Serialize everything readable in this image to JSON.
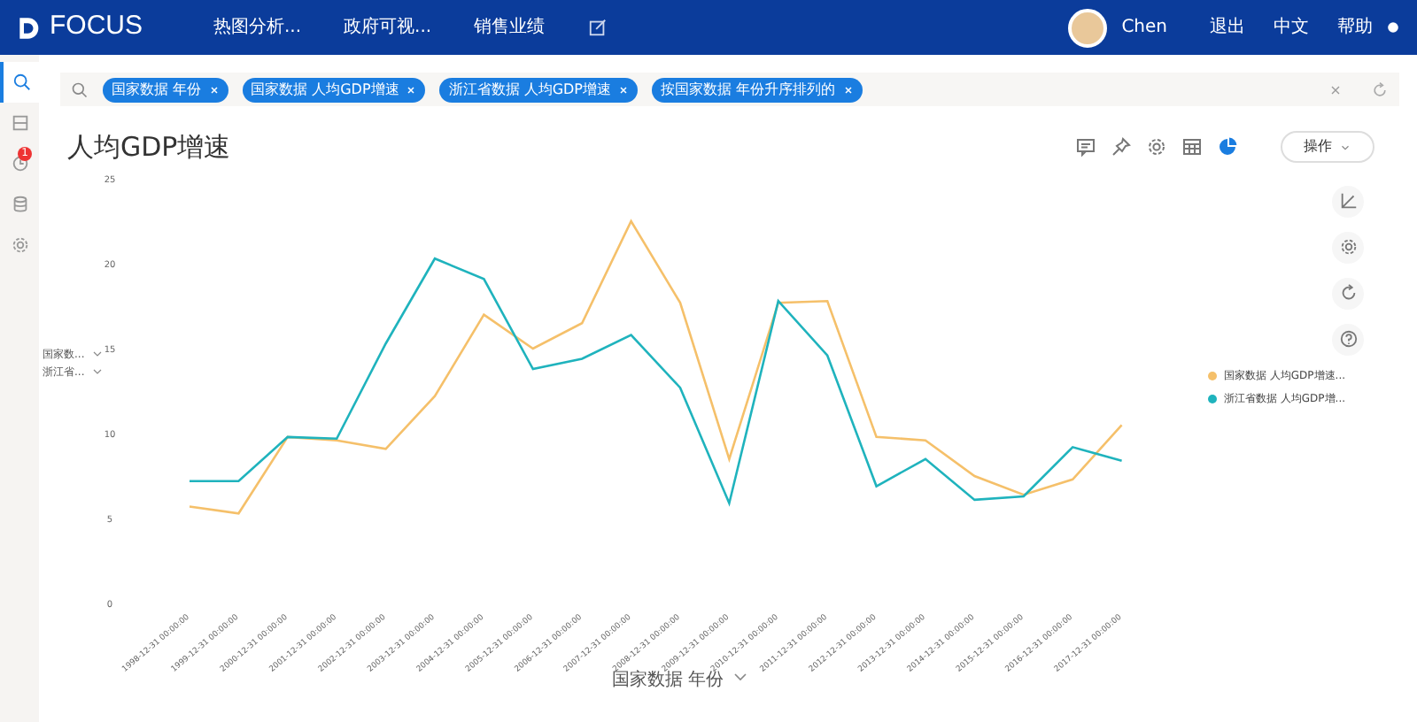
{
  "navbar": {
    "logo": "FOCUS",
    "menu": [
      {
        "label": "热图分析..."
      },
      {
        "label": "政府可视..."
      },
      {
        "label": "销售业绩"
      }
    ],
    "user": "Chen",
    "links": [
      "退出",
      "中文",
      "帮助"
    ]
  },
  "sidebar": {
    "items": [
      {
        "kind": "search",
        "selected": true
      },
      {
        "kind": "board",
        "selected": false
      },
      {
        "kind": "clock",
        "selected": false,
        "badge": "1"
      },
      {
        "kind": "database",
        "selected": false
      },
      {
        "kind": "gear",
        "selected": false
      }
    ]
  },
  "search": {
    "chips": [
      "国家数据 年份",
      "国家数据 人均GDP增速",
      "浙江省数据 人均GDP增速",
      "按国家数据 年份升序排列的"
    ]
  },
  "title": "人均GDP增速",
  "toolbar": {
    "tools": [
      {
        "kind": "comment",
        "selected": false
      },
      {
        "kind": "pin",
        "selected": false
      },
      {
        "kind": "gear",
        "selected": false
      },
      {
        "kind": "table",
        "selected": false
      },
      {
        "kind": "chart",
        "selected": true
      }
    ],
    "action": "操作"
  },
  "chart": {
    "axis_selectors": [
      "国家数...",
      "浙江省..."
    ],
    "legend": [
      "国家数据 人均GDP增速...",
      "浙江省数据 人均GDP增..."
    ],
    "side_tools": [
      {
        "kind": "axes"
      },
      {
        "kind": "gear"
      },
      {
        "kind": "refresh"
      },
      {
        "kind": "help"
      }
    ],
    "chart_data": {
      "type": "line",
      "xlabel": "国家数据 年份",
      "categories": [
        "1998-12-31 00:00:00",
        "1999-12-31 00:00:00",
        "2000-12-31 00:00:00",
        "2001-12-31 00:00:00",
        "2002-12-31 00:00:00",
        "2003-12-31 00:00:00",
        "2004-12-31 00:00:00",
        "2005-12-31 00:00:00",
        "2006-12-31 00:00:00",
        "2007-12-31 00:00:00",
        "2008-12-31 00:00:00",
        "2009-12-31 00:00:00",
        "2010-12-31 00:00:00",
        "2011-12-31 00:00:00",
        "2012-12-31 00:00:00",
        "2013-12-31 00:00:00",
        "2014-12-31 00:00:00",
        "2015-12-31 00:00:00",
        "2016-12-31 00:00:00",
        "2017-12-31 00:00:00"
      ],
      "ylim": [
        0,
        25
      ],
      "yticks": [
        0,
        5,
        10,
        15,
        20,
        25
      ],
      "series": [
        {
          "color": "#f5c06a",
          "values": [
            5.7,
            5.3,
            9.8,
            9.6,
            9.1,
            12.2,
            17,
            15,
            16.5,
            22.5,
            17.7,
            8.5,
            17.7,
            17.8,
            9.8,
            9.6,
            7.5,
            6.4,
            7.3,
            10.5
          ]
        },
        {
          "color": "#1fb3bd",
          "values": [
            7.2,
            7.2,
            9.8,
            9.7,
            15.3,
            20.3,
            19.1,
            13.8,
            14.4,
            15.8,
            12.7,
            5.9,
            17.8,
            14.6,
            6.9,
            8.5,
            6.1,
            6.3,
            9.2,
            8.4
          ]
        }
      ]
    }
  }
}
